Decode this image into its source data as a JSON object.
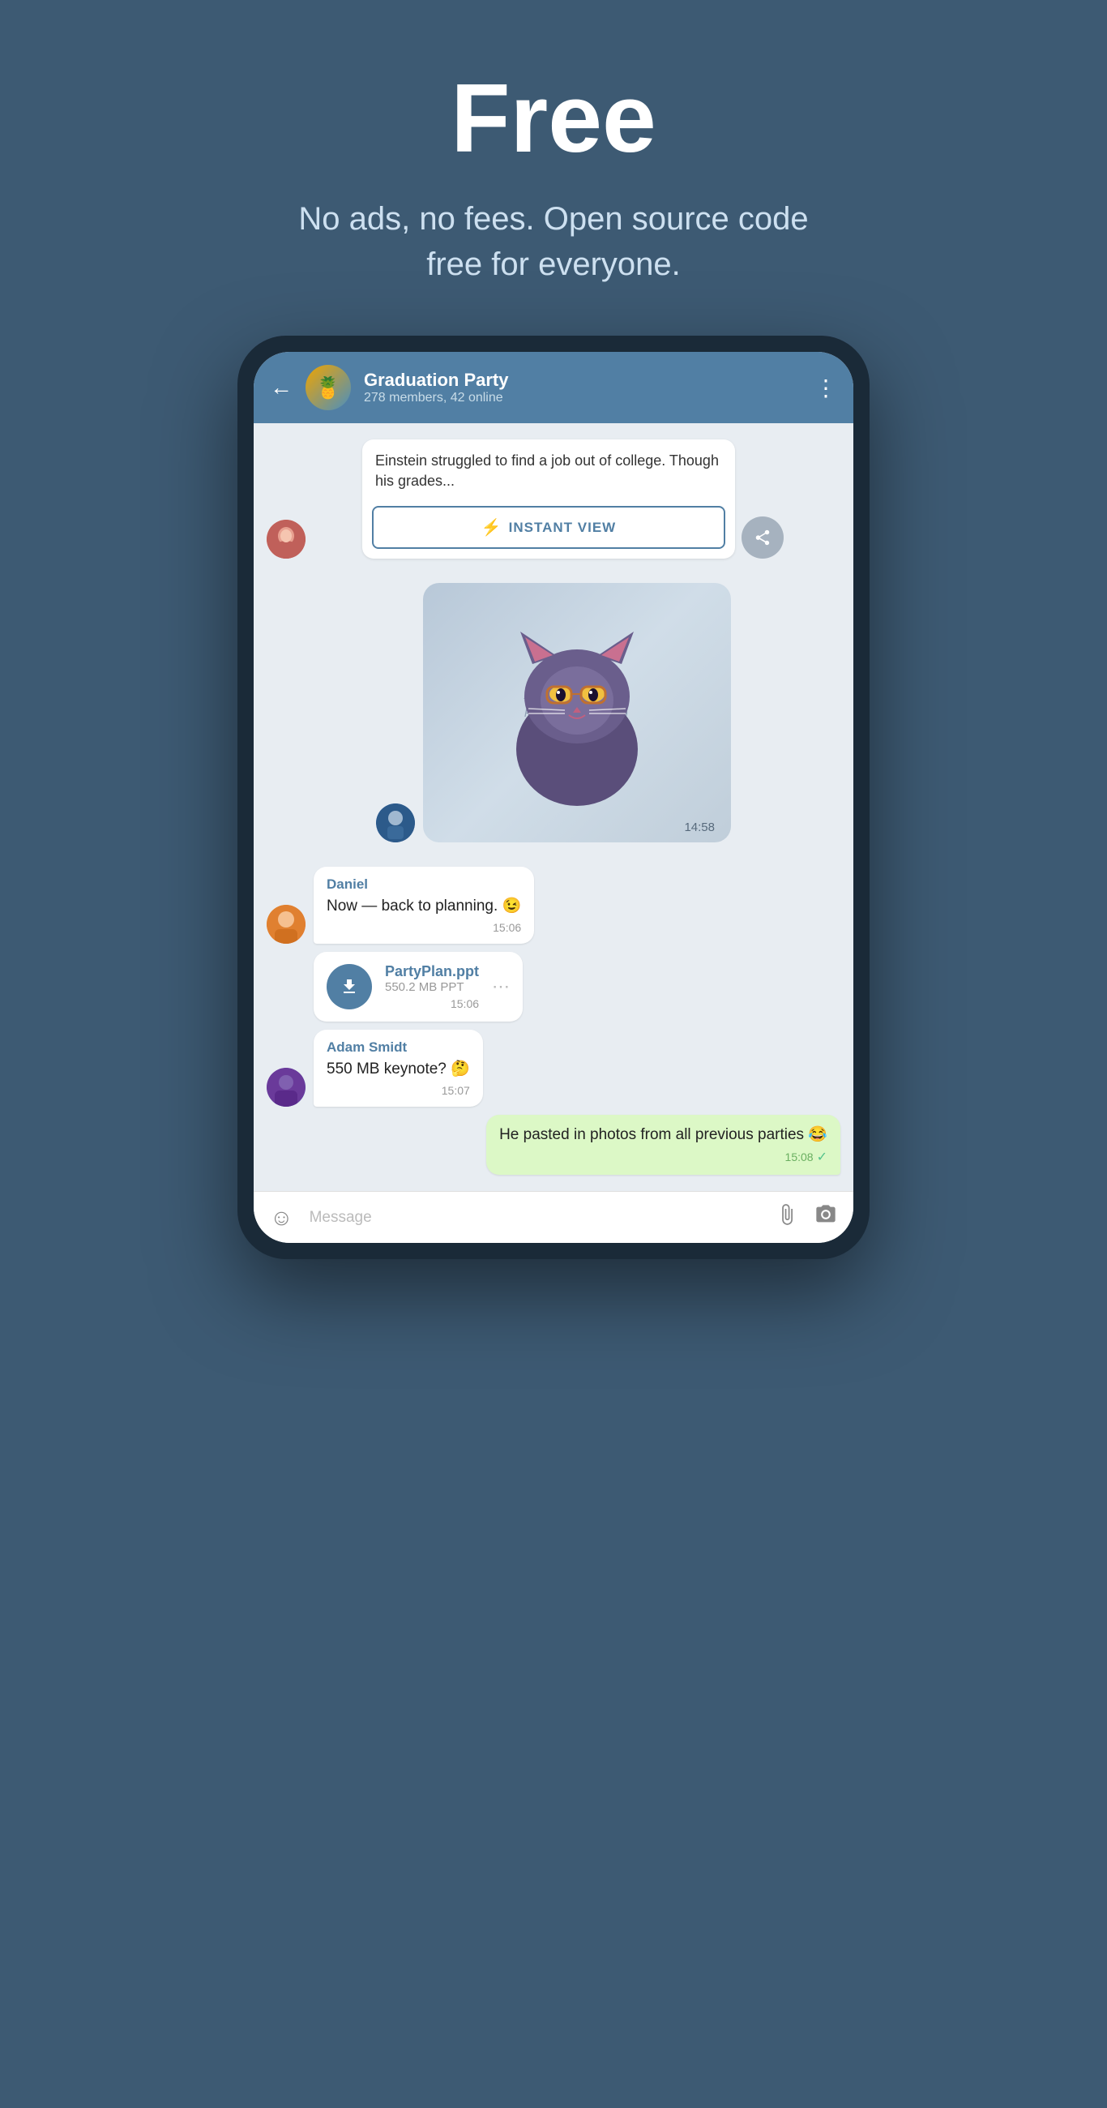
{
  "hero": {
    "title": "Free",
    "subtitle": "No ads, no fees. Open source code free for everyone."
  },
  "chat": {
    "back_label": "←",
    "group_name": "Graduation Party",
    "group_meta": "278 members, 42 online",
    "more_icon": "⋮",
    "article": {
      "text": "Einstein struggled to find a job out of college. Though his grades...",
      "iv_label": "INSTANT VIEW",
      "iv_icon": "⚡"
    },
    "sticker_time": "14:58",
    "messages": [
      {
        "id": "daniel_msg",
        "sender": "Daniel",
        "text": "Now — back to planning. 😉",
        "time": "15:06",
        "type": "incoming"
      },
      {
        "id": "file_msg",
        "file_name": "PartyPlan.ppt",
        "file_size": "550.2 MB PPT",
        "time": "15:06",
        "type": "file"
      },
      {
        "id": "adam_msg",
        "sender": "Adam Smidt",
        "text": "550 MB keynote? 🤔",
        "time": "15:07",
        "type": "incoming"
      },
      {
        "id": "self_msg",
        "text": "He pasted in photos from all previous parties 😂",
        "time": "15:08",
        "type": "outgoing"
      }
    ],
    "input_placeholder": "Message"
  }
}
